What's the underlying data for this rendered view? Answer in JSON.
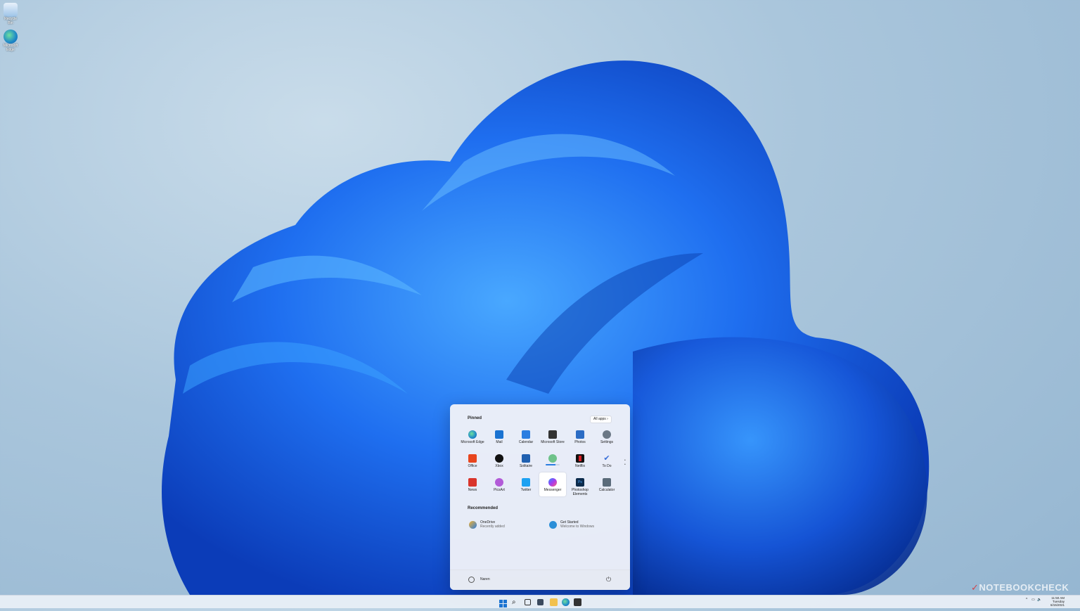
{
  "desktop": {
    "icons": [
      {
        "label": "Recycle Bin",
        "icon": "recycle-bin-icon"
      },
      {
        "label": "Microsoft Edge",
        "icon": "edge-icon"
      }
    ]
  },
  "start_menu": {
    "pinned_title": "Pinned",
    "all_apps_label": "All apps  ›",
    "pinned": [
      {
        "label": "Microsoft Edge",
        "icon": "edge-icon",
        "color": "#1e88c8"
      },
      {
        "label": "Mail",
        "icon": "mail-icon",
        "color": "#1a73d1"
      },
      {
        "label": "Calendar",
        "icon": "calendar-icon",
        "color": "#2a7de1"
      },
      {
        "label": "Microsoft Store",
        "icon": "store-icon",
        "color": "#333333"
      },
      {
        "label": "Photos",
        "icon": "photos-icon",
        "color": "#2b6cc4"
      },
      {
        "label": "Settings",
        "icon": "gear-icon",
        "color": "#6b7886"
      },
      {
        "label": "Office",
        "icon": "office-icon",
        "color": "#e8451e"
      },
      {
        "label": "Xbox",
        "icon": "xbox-icon",
        "color": "#111111"
      },
      {
        "label": "Solitaire",
        "icon": "solitaire-icon",
        "color": "#2060b0"
      },
      {
        "label": "",
        "icon": "spotify-icon",
        "color": "#6ec28a"
      },
      {
        "label": "Netflix",
        "icon": "netflix-icon",
        "color": "#d81f26"
      },
      {
        "label": "To Do",
        "icon": "check-icon",
        "color": "#3a6fd8"
      },
      {
        "label": "News",
        "icon": "news-icon",
        "color": "#d9342b"
      },
      {
        "label": "PicsArt",
        "icon": "picsart-icon",
        "color": "#b25bd8"
      },
      {
        "label": "Twitter",
        "icon": "twitter-icon",
        "color": "#1da1f2"
      },
      {
        "label": "Messenger",
        "icon": "messenger-icon",
        "color": "#8a4cf0"
      },
      {
        "label": "Photoshop Elements",
        "icon": "photoshop-icon",
        "color": "#0c2b4c"
      },
      {
        "label": "Calculator",
        "icon": "calculator-icon",
        "color": "#5a6b7a"
      }
    ],
    "recommended_title": "Recommended",
    "recommended": [
      {
        "title": "OneDrive",
        "subtitle": "Recently added",
        "icon": "onedrive-icon",
        "color": "#f2b233"
      },
      {
        "title": "Get Started",
        "subtitle": "Welcome to Windows",
        "icon": "get-started-icon",
        "color": "#2b8fd8"
      }
    ],
    "user_name": "Naren",
    "power_icon": "power-icon"
  },
  "taskbar": {
    "clock_time": "11:50 AM",
    "clock_day": "Tuesday",
    "clock_date": "6/15/2021"
  },
  "watermark": {
    "brand": "NOTEBOOKCHECK"
  }
}
